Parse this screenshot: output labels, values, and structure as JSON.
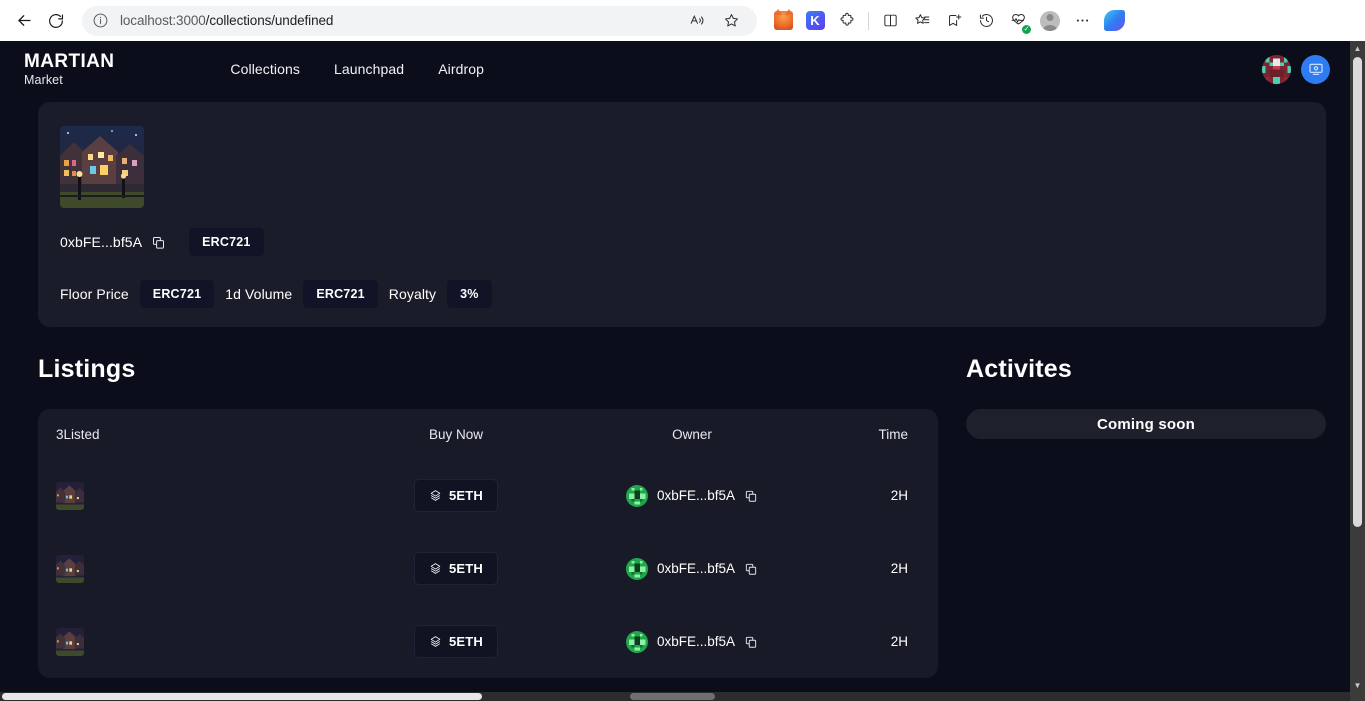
{
  "browser": {
    "url_full": "localhost:3000/collections/undefined",
    "url_host": "localhost:3000",
    "url_path": "/collections/undefined",
    "back_label": "Back",
    "refresh_label": "Refresh",
    "read_aloud_label": "Read aloud",
    "favorite_label": "Add this page to favorites",
    "extension_metamask_label": "MetaMask",
    "extension_keplr_label": "K",
    "extensions_label": "Extensions",
    "split_screen_label": "Split screen",
    "collections_label": "Collections",
    "add_favorite_label": "Add to favorites",
    "history_label": "History",
    "browser_essentials_label": "Browser essentials",
    "profile_label": "Profile",
    "settings_more_label": "Settings and more",
    "copilot_label": "Copilot"
  },
  "header": {
    "brand_top": "MARTIAN",
    "brand_sub": "Market",
    "nav": [
      {
        "label": "Collections"
      },
      {
        "label": "Launchpad"
      },
      {
        "label": "Airdrop"
      }
    ],
    "avatar_label": "Profile avatar",
    "wallet_label": "Connect wallet"
  },
  "collection": {
    "thumbnail_alt": "Collection cover art",
    "address": "0xbFE...bf5A",
    "copy_label": "Copy address",
    "token_standard": "ERC721",
    "stats": [
      {
        "label": "Floor Price",
        "value": "ERC721"
      },
      {
        "label": "1d Volume",
        "value": "ERC721"
      },
      {
        "label": "Royalty",
        "value": "3%"
      }
    ]
  },
  "listings": {
    "title": "Listings",
    "columns": {
      "item": "3Listed",
      "price": "Buy Now",
      "owner": "Owner",
      "time": "Time"
    },
    "rows": [
      {
        "thumb_alt": "NFT thumbnail",
        "price": "5ETH",
        "owner": "0xbFE...bf5A",
        "copy_label": "Copy owner address",
        "time": "2H"
      },
      {
        "thumb_alt": "NFT thumbnail",
        "price": "5ETH",
        "owner": "0xbFE...bf5A",
        "copy_label": "Copy owner address",
        "time": "2H"
      },
      {
        "thumb_alt": "NFT thumbnail",
        "price": "5ETH",
        "owner": "0xbFE...bf5A",
        "copy_label": "Copy owner address",
        "time": "2H"
      }
    ]
  },
  "activities": {
    "title": "Activites",
    "placeholder": "Coming soon"
  },
  "colors": {
    "page_bg": "#0b0e1a",
    "card_bg": "#1a1d29",
    "listings_bg": "#181b27",
    "badge_bg": "#111426",
    "accent_blue": "#2f7bf2",
    "text": "#ffffff"
  }
}
